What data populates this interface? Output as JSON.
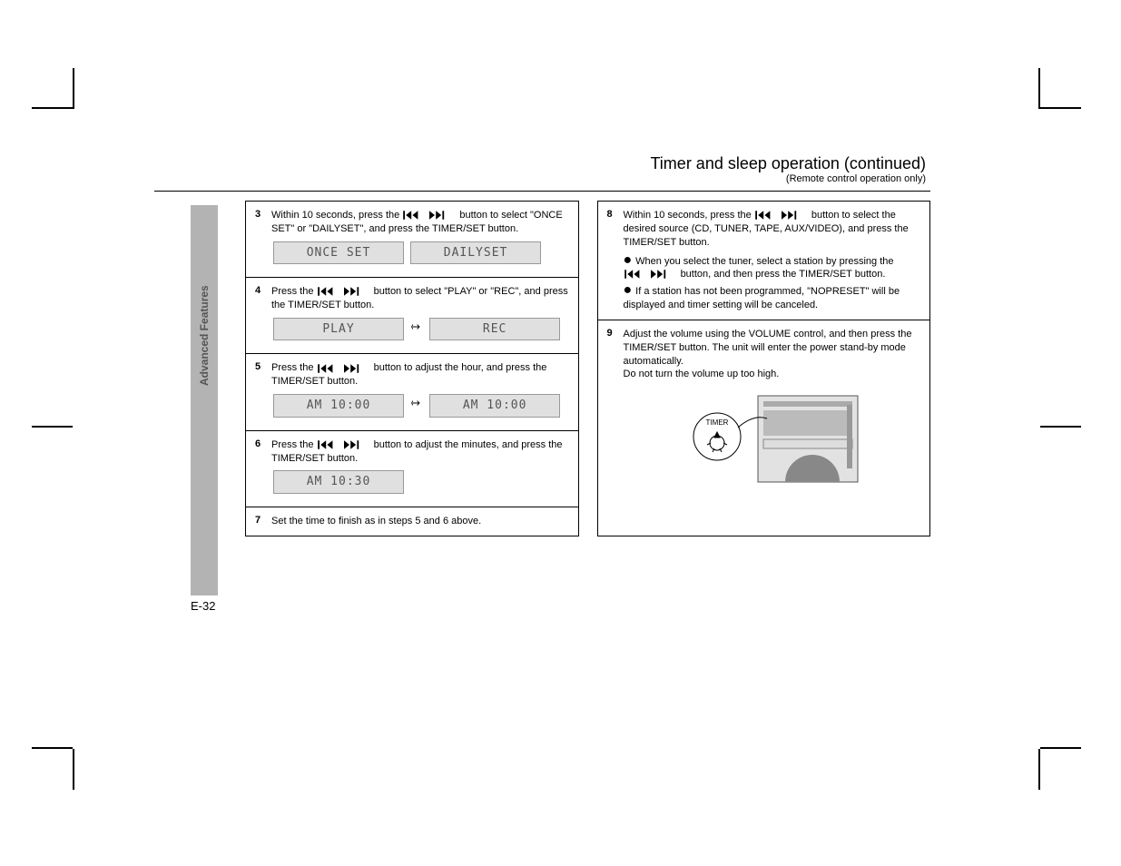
{
  "sidebar": {
    "label": "Advanced Features",
    "page": "E-32"
  },
  "header": {
    "title": "Timer and sleep operation (continued)",
    "sub": "(Remote control operation only)"
  },
  "left": {
    "s3": {
      "num": "3",
      "text_a": "Within 10 seconds, press the ",
      "text_b": " button to select \"ONCE SET\" or \"DAILYSET\", and press the TIMER/SET button.",
      "lcd_a": "ONCE SET",
      "lcd_b": "DAILYSET"
    },
    "s4": {
      "num": "4",
      "text_a": "Press the ",
      "text_b": " button to select \"PLAY\" or \"REC\", and press the TIMER/SET button.",
      "lcd_a": "PLAY",
      "lcd_b": "REC"
    },
    "s5": {
      "num": "5",
      "text_a": "Press the ",
      "text_b": " button to adjust the hour, and press the TIMER/SET button.",
      "lcd_a": "AM 10:00",
      "lcd_b": "AM 10:00"
    },
    "s6": {
      "num": "6",
      "text_a": "Press the ",
      "text_b": " button to adjust the minutes, and press the TIMER/SET button.",
      "lcd_a": "AM 10:30"
    },
    "s7": {
      "num": "7",
      "text": "Set the time to finish as in steps 5 and 6 above."
    }
  },
  "right": {
    "s8": {
      "num": "8",
      "text_a": "Within 10 seconds, press the ",
      "text_b": " button to select the desired source (CD, TUNER, TAPE, AUX/VIDEO), and press the TIMER/SET button.",
      "sub_a": "When you select the tuner, select a station by pressing the ",
      "sub_b": " button, and then press the TIMER/SET button.",
      "sub_c": "If a station has not been programmed, \"NOPRESET\" will be displayed and timer setting will be canceled."
    },
    "s9": {
      "num": "9",
      "text": "Adjust the volume using the VOLUME control, and then press the TIMER/SET button. The unit will enter the power stand-by mode automatically.",
      "note": "Do not turn the volume up too high.",
      "timer_label": "TIMER"
    }
  }
}
